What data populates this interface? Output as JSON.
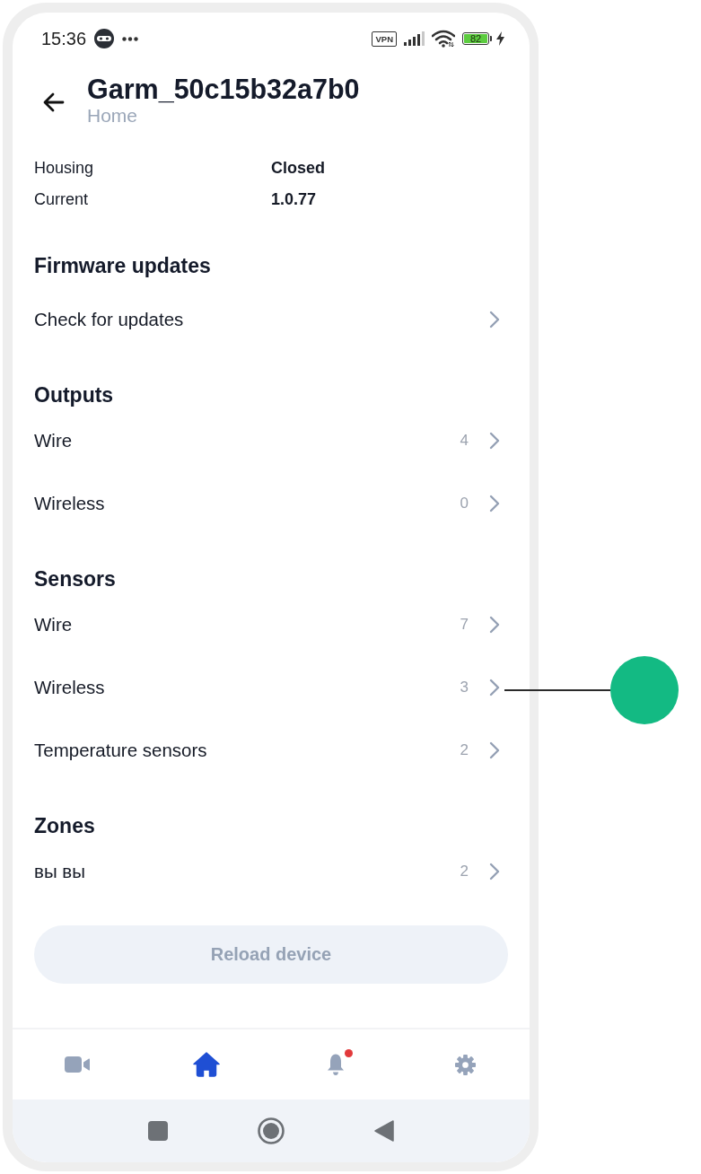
{
  "status_bar": {
    "time": "15:36",
    "vpn": "VPN",
    "battery": "82"
  },
  "header": {
    "title": "Garm_50c15b32a7b0",
    "subtitle": "Home"
  },
  "info": [
    {
      "label": "Housing",
      "value": "Closed"
    },
    {
      "label": "Current",
      "value": "1.0.77"
    }
  ],
  "sections": [
    {
      "title": "Firmware updates",
      "items": [
        {
          "kind": "action",
          "label": "Check for updates"
        }
      ]
    },
    {
      "title": "Outputs",
      "items": [
        {
          "kind": "count",
          "label": "Wire",
          "count": "4"
        },
        {
          "kind": "count",
          "label": "Wireless",
          "count": "0"
        }
      ]
    },
    {
      "title": "Sensors",
      "items": [
        {
          "kind": "count",
          "label": "Wire",
          "count": "7"
        },
        {
          "kind": "count",
          "label": "Wireless",
          "count": "3"
        },
        {
          "kind": "count",
          "label": "Temperature sensors",
          "count": "2"
        }
      ]
    },
    {
      "title": "Zones",
      "items": [
        {
          "kind": "count",
          "label": "вы вы",
          "count": "2"
        }
      ]
    }
  ],
  "reload_button": {
    "label": "Reload device",
    "disabled": true
  },
  "bottom_nav": {
    "tabs": [
      {
        "selected": false,
        "badge": false
      },
      {
        "selected": true,
        "badge": false
      },
      {
        "selected": false,
        "badge": true
      },
      {
        "selected": false,
        "badge": false
      }
    ]
  }
}
